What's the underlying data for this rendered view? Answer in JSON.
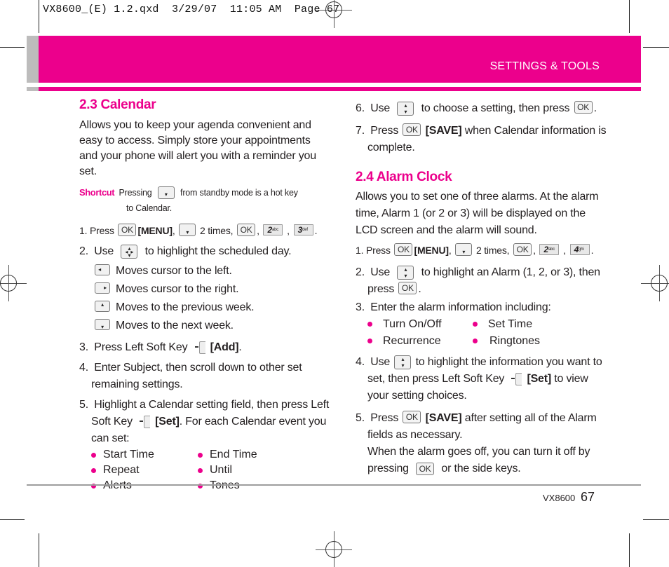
{
  "slug": "VX8600_(E) 1.2.qxd  3/29/07  11:05 AM  Page 67",
  "header": {
    "section_title": "SETTINGS & TOOLS"
  },
  "colors": {
    "accent": "#ec008c",
    "band_gray": "#bdbcbc",
    "rule_gray": "#9d9d9d"
  },
  "calendar": {
    "heading": "2.3 Calendar",
    "intro": "Allows you to keep your agenda convenient and easy to access. Simply store your appointments and your phone will alert you with a reminder you set.",
    "shortcut_label": "Shortcut",
    "shortcut_pre": "Pressing",
    "shortcut_post": "from standby mode is a hot key",
    "shortcut_line2": "to Calendar.",
    "step1": {
      "num": "1.",
      "press": "Press",
      "menu": "[MENU]",
      "times": "2 times,",
      "comma": ",",
      "period": "."
    },
    "step2": {
      "num": "2.",
      "pre": "Use",
      "post": "to highlight the scheduled day."
    },
    "nav_items": [
      {
        "icon": "nav-left-key-icon",
        "text": "Moves cursor to the left."
      },
      {
        "icon": "nav-right-key-icon",
        "text": "Moves cursor to the right."
      },
      {
        "icon": "nav-up-key-icon",
        "text": "Moves to the previous week."
      },
      {
        "icon": "nav-down-key-icon",
        "text": "Moves to the next week."
      }
    ],
    "step3": {
      "num": "3.",
      "pre": "Press Left Soft Key",
      "bold": "[Add]",
      "post": "."
    },
    "step4": {
      "num": "4.",
      "line1": "Enter Subject, then scroll down to other set",
      "line2": "remaining settings."
    },
    "step5": {
      "num": "5.",
      "line1": "Highlight a Calendar setting field, then press Left",
      "line2_pre": "Soft Key",
      "line2_bold": "[Set]",
      "line2_post": ". For each Calendar event you",
      "line3": "can set:"
    },
    "options": [
      "Start Time",
      "End Time",
      "Repeat",
      "Until",
      "Alerts",
      "Tones"
    ],
    "step6": {
      "num": "6.",
      "pre": "Use",
      "post": "to choose a setting, then press",
      "end": "."
    },
    "step7": {
      "num": "7.",
      "pre": "Press",
      "bold": "[SAVE]",
      "post": "when Calendar information is",
      "line2": "complete."
    }
  },
  "alarm": {
    "heading": "2.4 Alarm Clock",
    "intro": "Allows you to set one of three alarms. At the alarm time, Alarm 1 (or 2 or 3) will be displayed on the LCD screen and the alarm will sound.",
    "step1": {
      "num": "1.",
      "press": "Press",
      "menu": "[MENU]",
      "times": "2 times,",
      "comma": ",",
      "period": "."
    },
    "step2": {
      "num": "2.",
      "pre": "Use",
      "post": "to highlight an Alarm (1, 2, or 3), then",
      "line2_pre": "press",
      "line2_post": "."
    },
    "step3": {
      "num": "3.",
      "text": "Enter the alarm information including:"
    },
    "options": [
      "Turn On/Off",
      "Set Time",
      "Recurrence",
      "Ringtones"
    ],
    "step4": {
      "num": "4.",
      "pre": "Use",
      "post": "to highlight the information you want to",
      "line2_pre": "set, then press Left Soft Key",
      "line2_bold": "[Set]",
      "line2_post": "to view",
      "line3": "your setting choices."
    },
    "step5": {
      "num": "5.",
      "pre": "Press",
      "bold": "[SAVE]",
      "post": "after setting all of the Alarm",
      "line2": "fields as necessary.",
      "line3": "When the alarm goes off, you can turn it off by",
      "line4_pre": "pressing",
      "line4_post": "or the side keys."
    }
  },
  "keys": {
    "ok": "OK",
    "num2": "2",
    "num2_sub": "abc",
    "num3": "3",
    "num3_sub": "def",
    "num4": "4",
    "num4_sub": "ghi"
  },
  "footer": {
    "model": "VX8600",
    "page": "67"
  }
}
